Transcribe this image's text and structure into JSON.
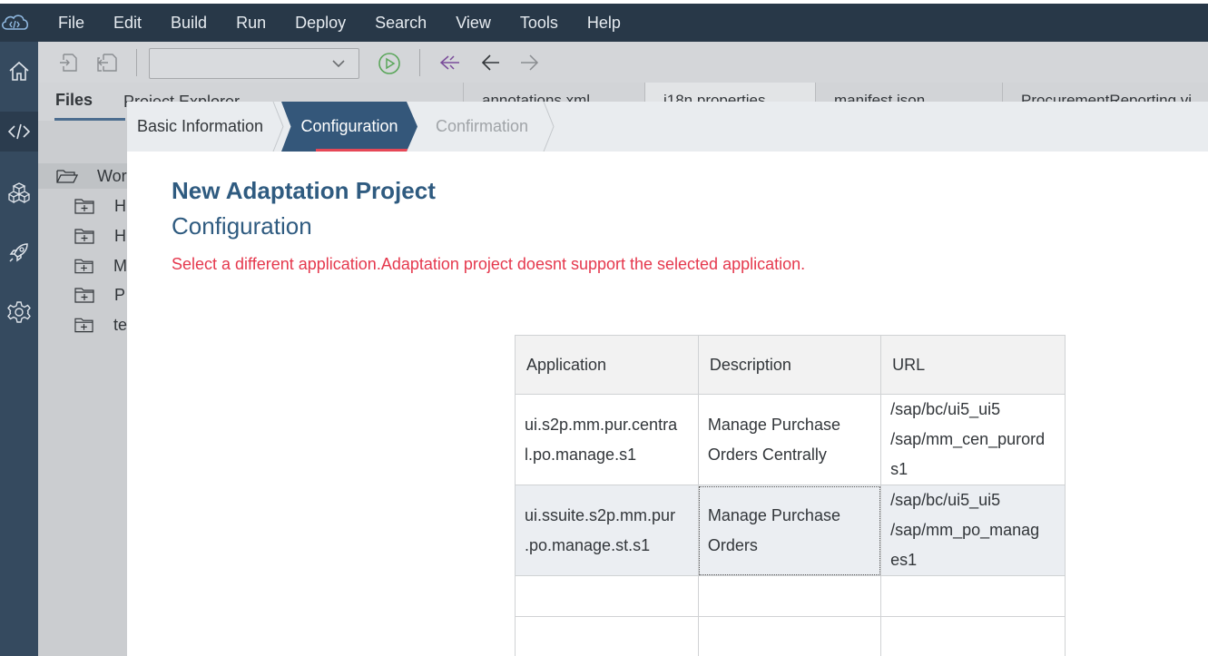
{
  "menubar": {
    "items": [
      "File",
      "Edit",
      "Build",
      "Run",
      "Deploy",
      "Search",
      "View",
      "Tools",
      "Help"
    ]
  },
  "rail": {
    "icons": [
      "home-icon",
      "code-icon",
      "cubes-icon",
      "rocket-icon",
      "gear-icon"
    ]
  },
  "toolbar": {
    "run_config_value": ""
  },
  "panels": {
    "files_tab": "Files",
    "explorer_tab": "Project Explorer"
  },
  "editor_tabs": [
    "annotations.xml",
    "i18n.properties",
    "manifest.json",
    "ProcurementReporting.vi"
  ],
  "tree": {
    "workspace": "Wor",
    "items": [
      "H",
      "H",
      "M",
      "P",
      "te"
    ]
  },
  "wizard": {
    "steps": [
      "Basic Information",
      "Configuration",
      "Confirmation"
    ],
    "active_step": "Configuration"
  },
  "dialog": {
    "title": "New Adaptation Project",
    "subtitle": "Configuration",
    "error": "Select a different application.Adaptation project doesnt support the selected application."
  },
  "table": {
    "headers": [
      "Application",
      "Description",
      "URL"
    ],
    "rows": [
      {
        "application": [
          "ui.s2p.mm.pur.centra",
          "l.po.manage.s1"
        ],
        "description": [
          "Manage Purchase",
          "Orders Centrally"
        ],
        "url": [
          "/sap/bc/ui5_ui5",
          "/sap/mm_cen_purord",
          "s1"
        ]
      },
      {
        "application": [
          "ui.ssuite.s2p.mm.pur",
          ".po.manage.st.s1"
        ],
        "description": [
          "Manage Purchase",
          "Orders"
        ],
        "url": [
          "/sap/bc/ui5_ui5",
          "/sap/mm_po_manag",
          "es1"
        ]
      }
    ]
  },
  "colors": {
    "menubar_bg": "#283848",
    "rail_bg": "#354a5f",
    "active_step_bg": "#34577a",
    "title_color": "#2f5b80",
    "error_color": "#e5384d"
  }
}
